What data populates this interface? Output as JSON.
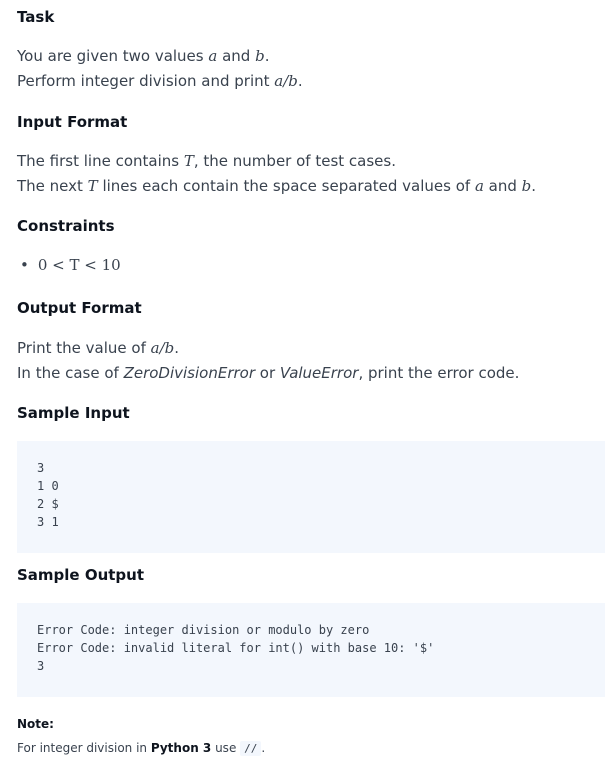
{
  "task": {
    "heading": "Task",
    "line1": {
      "pre": "You are given two values ",
      "a": "a",
      "mid": " and ",
      "b": "b",
      "post": "."
    },
    "line2": {
      "pre": "Perform integer division and print ",
      "expr": "a/b",
      "post": "."
    }
  },
  "input_format": {
    "heading": "Input Format",
    "line1": {
      "pre": "The first line contains ",
      "T": "T",
      "post": ", the number of test cases."
    },
    "line2": {
      "pre": "The next ",
      "T": "T",
      "mid": " lines each contain the space separated values of ",
      "a": "a",
      "and": " and ",
      "b": "b",
      "post": "."
    }
  },
  "constraints": {
    "heading": "Constraints",
    "items": [
      {
        "bullet": "•",
        "text": "0 < T < 10"
      }
    ]
  },
  "output_format": {
    "heading": "Output Format",
    "line1": {
      "pre": "Print the value of ",
      "expr": "a/b",
      "post": "."
    },
    "line2": {
      "pre": "In the case of ",
      "err1": "ZeroDivisionError",
      "or": " or ",
      "err2": "ValueError",
      "post": ", print the error code."
    }
  },
  "sample_input": {
    "heading": "Sample Input",
    "lines": [
      "3",
      "1 0",
      "2 $",
      "3 1"
    ]
  },
  "sample_output": {
    "heading": "Sample Output",
    "lines": [
      "Error Code: integer division or modulo by zero",
      "Error Code: invalid literal for int() with base 10: '$'",
      "3"
    ]
  },
  "note": {
    "title": "Note:",
    "pre": "For integer division in ",
    "bold": "Python 3",
    "mid": " use ",
    "code": "//",
    "post": "."
  }
}
